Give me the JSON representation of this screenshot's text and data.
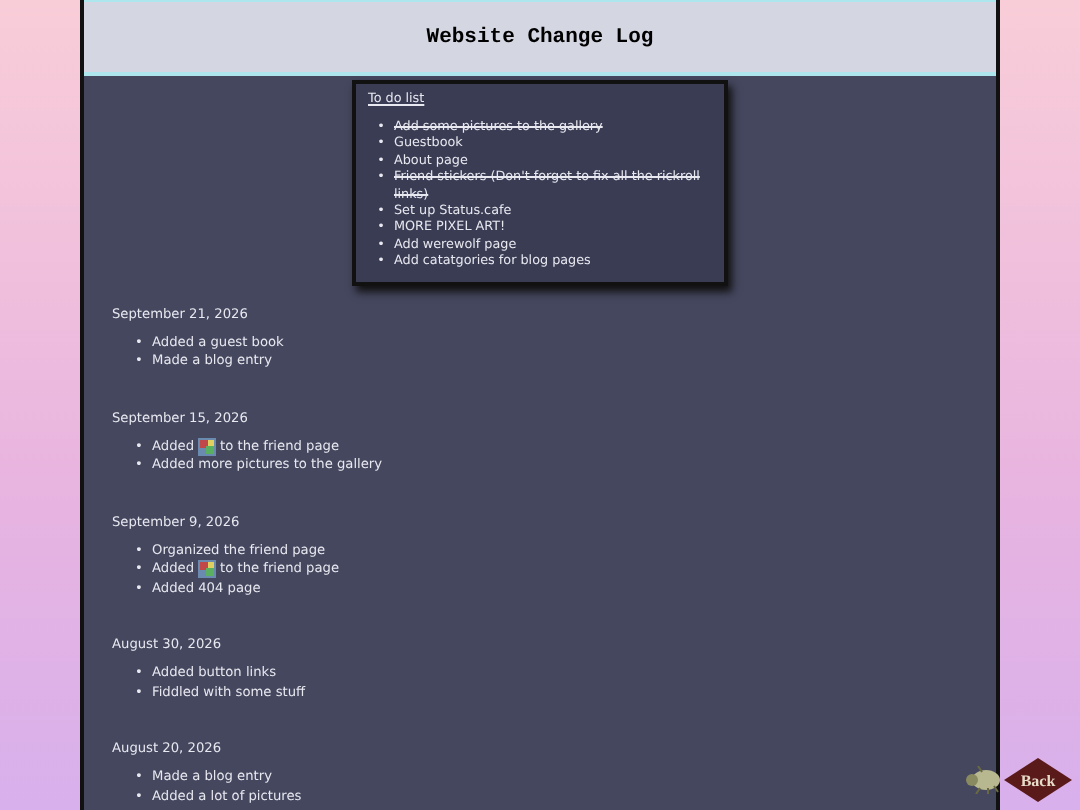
{
  "header": {
    "title": "Website Change Log"
  },
  "todo": {
    "title": "To do list",
    "items": [
      {
        "bullet": "•",
        "text": "Add some pictures to the gallery",
        "done": true
      },
      {
        "bullet": "•",
        "text": "Guestbook",
        "done": false
      },
      {
        "bullet": "•",
        "text": "About page",
        "done": false
      },
      {
        "bullet": "•",
        "text": "Friend stickers (Don't forget to fix all the rickroll links)",
        "done": true
      },
      {
        "bullet": "•",
        "text": "Set up Status.cafe",
        "done": false
      },
      {
        "bullet": "•",
        "text": "MORE PIXEL ART!",
        "done": false
      },
      {
        "bullet": "•",
        "text": "Add werewolf page",
        "done": false
      },
      {
        "bullet": "•",
        "text": "Add catatgories for blog pages",
        "done": false
      }
    ]
  },
  "entries": [
    {
      "date": "September 21, 2026",
      "items": [
        {
          "kind": "text",
          "bullet": "•",
          "text": "Added a guest book"
        },
        {
          "kind": "text",
          "bullet": "•",
          "text": "Made a blog entry"
        }
      ]
    },
    {
      "date": "September 15, 2026",
      "items": [
        {
          "kind": "with_icon",
          "bullet": "•",
          "before": "Added",
          "after": "to the friend page"
        },
        {
          "kind": "text",
          "bullet": "•",
          "text": "Added more pictures to the gallery"
        }
      ]
    },
    {
      "date": "September 9, 2026",
      "items": [
        {
          "kind": "text",
          "bullet": "•",
          "text": "Organized the friend page"
        },
        {
          "kind": "with_icon",
          "bullet": "•",
          "before": "Added",
          "after": "to the friend page"
        },
        {
          "kind": "text",
          "bullet": "•",
          "text": "Added 404 page"
        }
      ]
    },
    {
      "date": "August 30, 2026",
      "items": [
        {
          "kind": "text",
          "bullet": "•",
          "text": "Added button links"
        },
        {
          "kind": "text",
          "bullet": "•",
          "text": "Fiddled with some stuff"
        }
      ]
    },
    {
      "date": "August 20, 2026",
      "items": [
        {
          "kind": "text",
          "bullet": "•",
          "text": "Made a blog entry"
        },
        {
          "kind": "text",
          "bullet": "•",
          "text": "Added a lot of pictures"
        }
      ]
    }
  ],
  "back_button": {
    "label": "Back"
  }
}
